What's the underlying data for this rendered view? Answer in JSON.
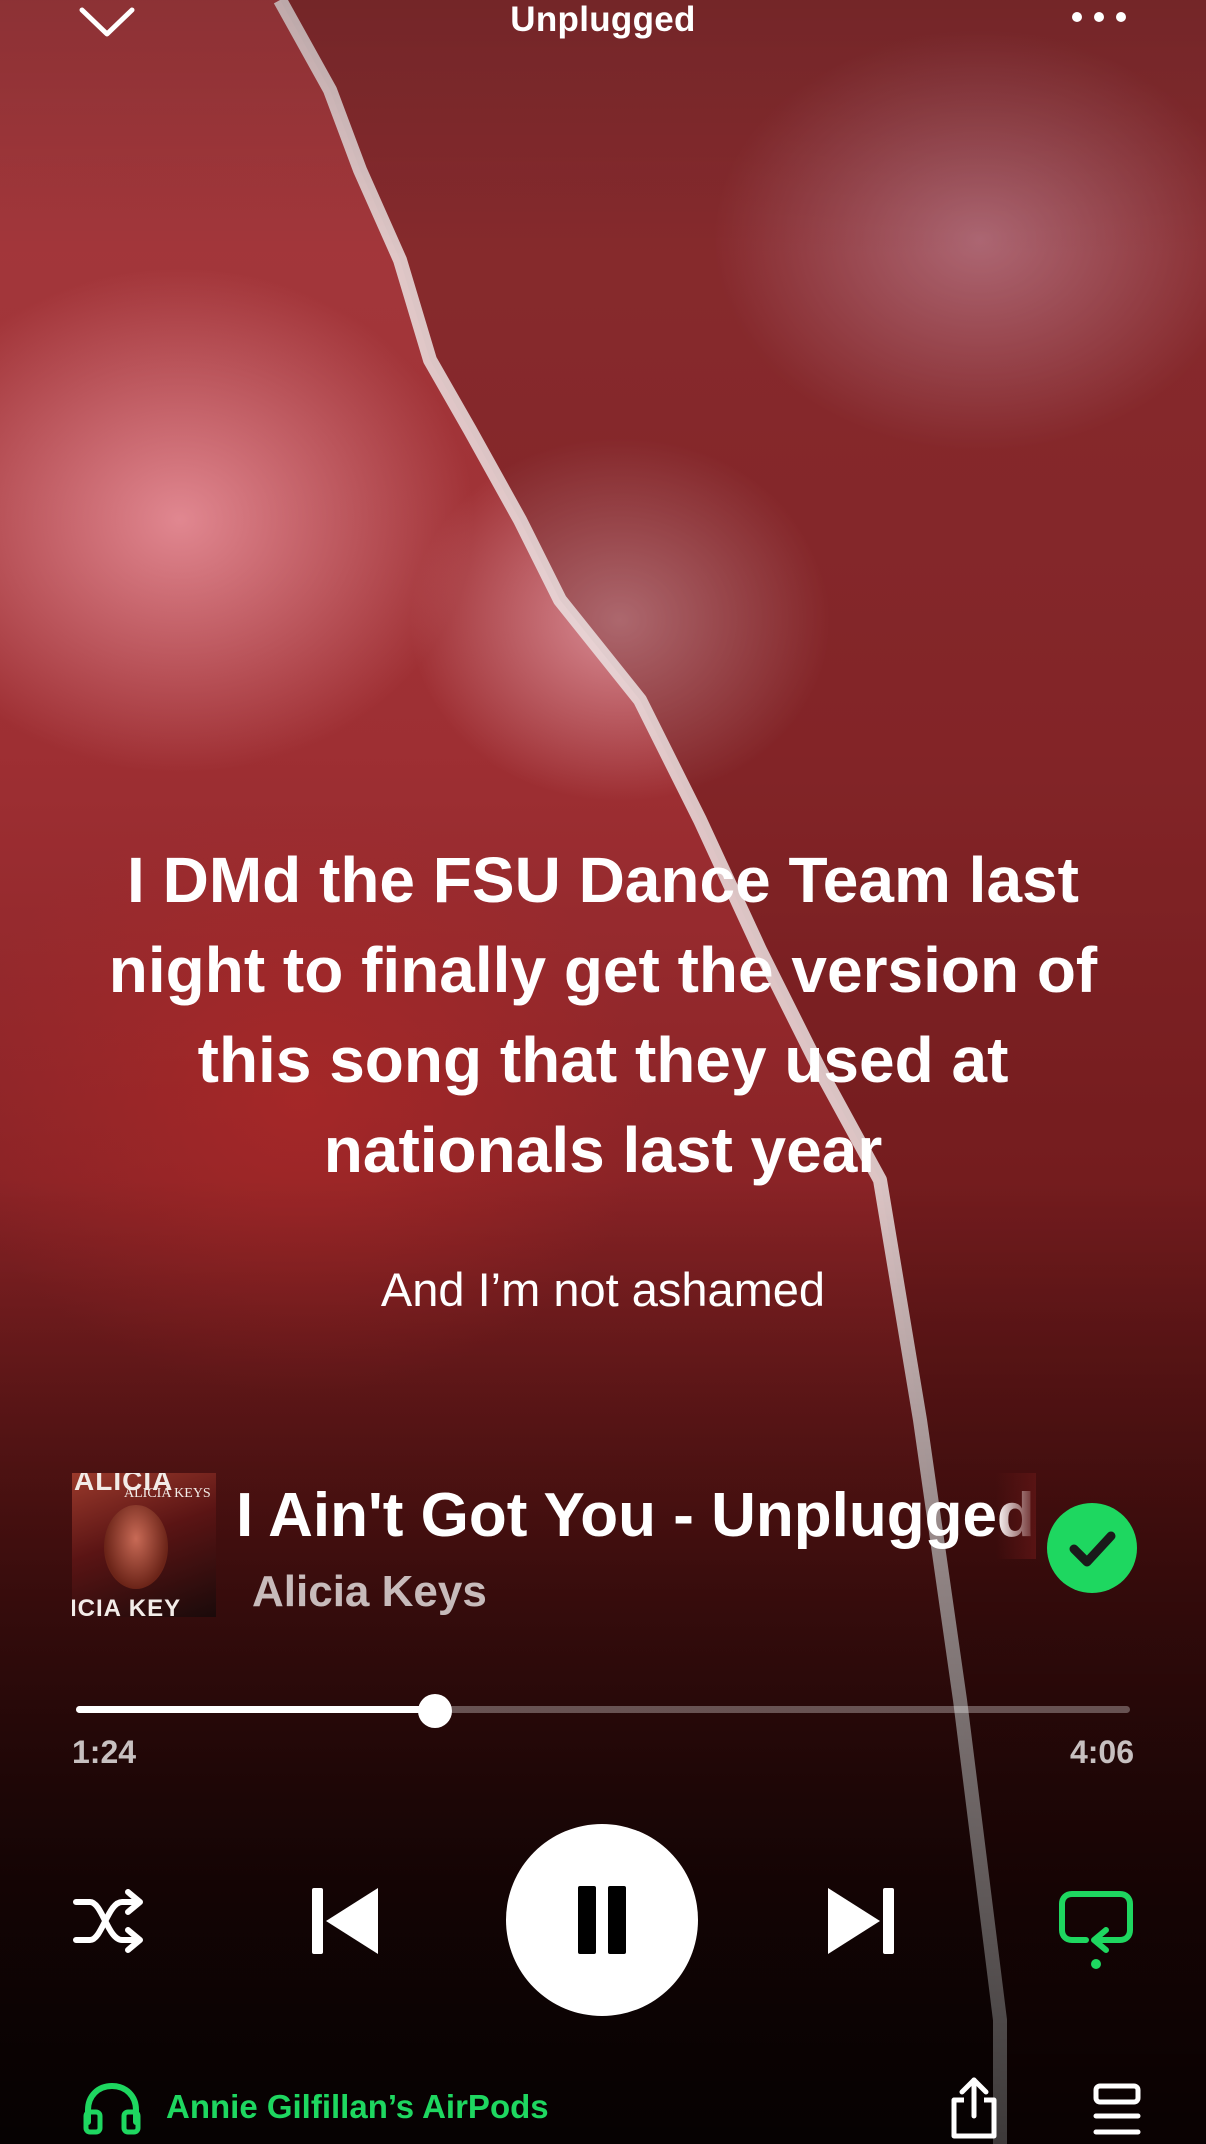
{
  "header": {
    "title": "Unplugged"
  },
  "lyrics": {
    "main": "I DMd the FSU Dance Team last night to finally get the version of this song that they used at nationals last year",
    "sub": "And I’m not ashamed"
  },
  "track": {
    "title": "I Ain't Got You - Unplugged",
    "artist": "Alicia Keys",
    "cover_text_top": "ALICIA",
    "cover_text_small": "ALICIA KEYS",
    "cover_text_bottom": "ICIA KEY",
    "liked": true
  },
  "playback": {
    "elapsed": "1:24",
    "total": "4:06",
    "progress_fraction": 0.341,
    "state": "playing",
    "repeat": "on"
  },
  "footer": {
    "device_name": "Annie Gilfillan’s AirPods"
  },
  "colors": {
    "accent": "#1ed760",
    "background": "#8a2326"
  },
  "icons": [
    "chevron-down-icon",
    "more-icon",
    "checkmark-icon",
    "shuffle-icon",
    "previous-icon",
    "pause-icon",
    "next-icon",
    "repeat-icon",
    "headphones-icon",
    "share-icon",
    "queue-icon"
  ]
}
